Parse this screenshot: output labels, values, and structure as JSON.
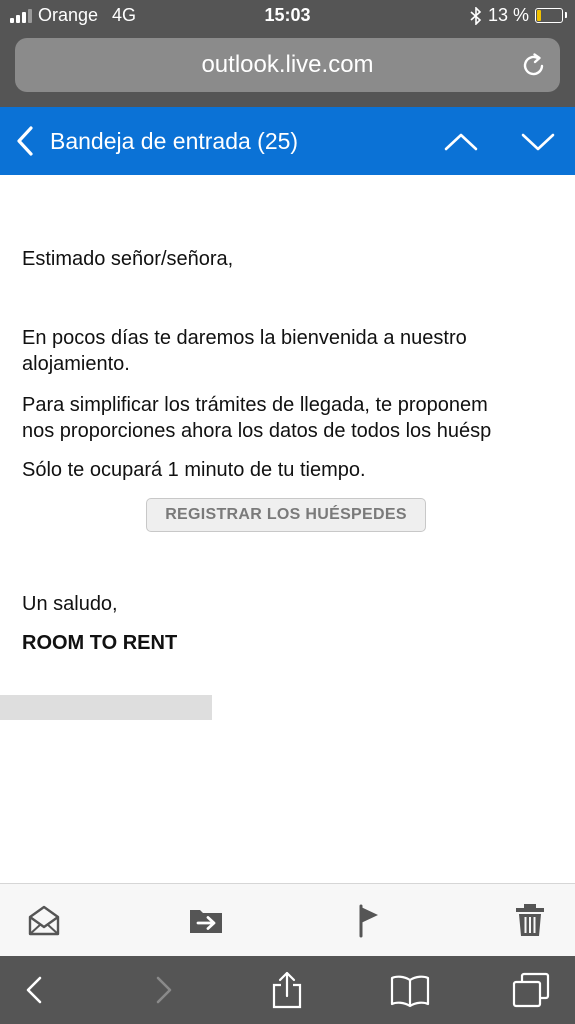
{
  "status_bar": {
    "carrier": "Orange",
    "network": "4G",
    "time": "15:03",
    "battery": "13 %",
    "battery_level": 0.13,
    "battery_color": "#f2c200"
  },
  "browser": {
    "url": "outlook.live.com"
  },
  "mail_header": {
    "title": "Bandeja de entrada (25)",
    "accent": "#0b72d6"
  },
  "email": {
    "greeting": "Estimado señor/señora,",
    "para1_line1": "En pocos días te daremos la bienvenida a nuestro",
    "para1_line2": "alojamiento.",
    "para2_line1": "Para simplificar los trámites de llegada, te proponem",
    "para2_line2": "nos proporciones ahora los datos de todos los huésp",
    "para3": "Sólo te ocupará 1 minuto de tu tiempo.",
    "button_label": "REGISTRAR LOS HUÉSPEDES",
    "closing": "Un saludo,",
    "signature": "ROOM TO RENT"
  },
  "toolbar_icons": [
    "mark-read-icon",
    "move-icon",
    "flag-icon",
    "delete-icon"
  ],
  "safari_icons": [
    "back-icon",
    "forward-icon",
    "share-icon",
    "bookmarks-icon",
    "tabs-icon"
  ]
}
